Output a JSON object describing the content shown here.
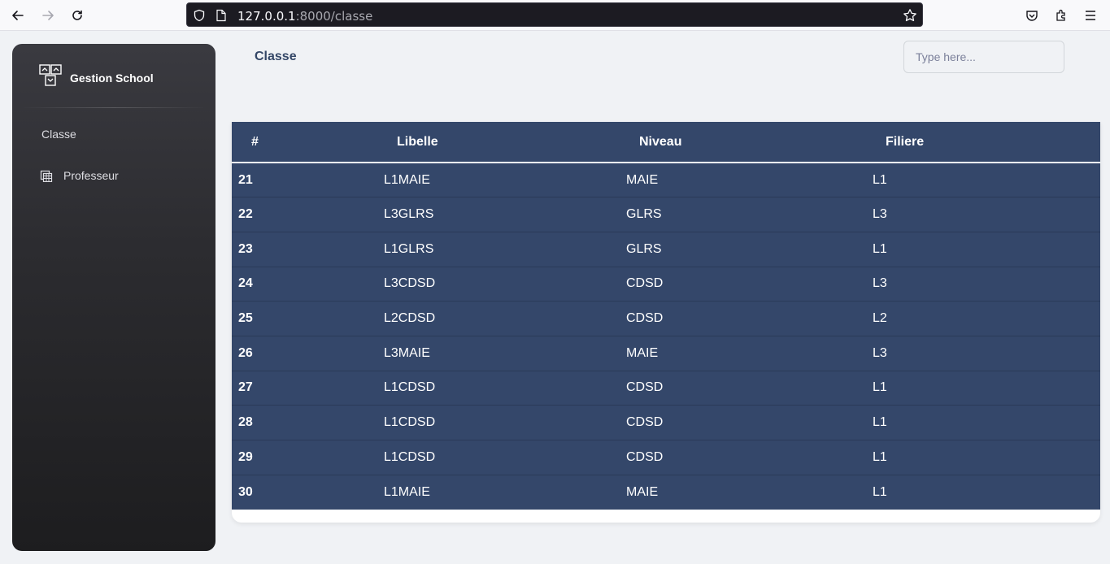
{
  "browser": {
    "url_host": "127.0.0.1",
    "url_path": ":8000/classe"
  },
  "sidebar": {
    "brand": "Gestion School",
    "items": [
      {
        "label": "Classe"
      },
      {
        "label": "Professeur",
        "icon": "table-icon"
      }
    ]
  },
  "header": {
    "title": "Classe",
    "search_placeholder": "Type here..."
  },
  "table": {
    "columns": [
      "#",
      "Libelle",
      "Niveau",
      "Filiere"
    ],
    "rows": [
      {
        "id": "21",
        "libelle": "L1MAIE",
        "niveau": "MAIE",
        "filiere": "L1"
      },
      {
        "id": "22",
        "libelle": "L3GLRS",
        "niveau": "GLRS",
        "filiere": "L3"
      },
      {
        "id": "23",
        "libelle": "L1GLRS",
        "niveau": "GLRS",
        "filiere": "L1"
      },
      {
        "id": "24",
        "libelle": "L3CDSD",
        "niveau": "CDSD",
        "filiere": "L3"
      },
      {
        "id": "25",
        "libelle": "L2CDSD",
        "niveau": "CDSD",
        "filiere": "L2"
      },
      {
        "id": "26",
        "libelle": "L3MAIE",
        "niveau": "MAIE",
        "filiere": "L3"
      },
      {
        "id": "27",
        "libelle": "L1CDSD",
        "niveau": "CDSD",
        "filiere": "L1"
      },
      {
        "id": "28",
        "libelle": "L1CDSD",
        "niveau": "CDSD",
        "filiere": "L1"
      },
      {
        "id": "29",
        "libelle": "L1CDSD",
        "niveau": "CDSD",
        "filiere": "L1"
      },
      {
        "id": "30",
        "libelle": "L1MAIE",
        "niveau": "MAIE",
        "filiere": "L1"
      }
    ]
  },
  "colors": {
    "table_bg": "#34476a",
    "title": "#344767",
    "page_bg": "#f0f2f5"
  }
}
